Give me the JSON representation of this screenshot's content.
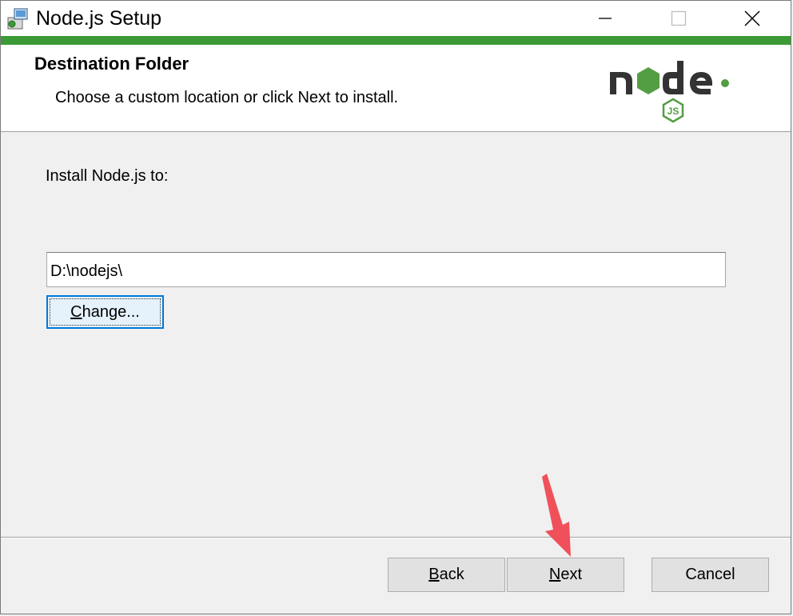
{
  "window": {
    "title": "Node.js Setup"
  },
  "header": {
    "title": "Destination Folder",
    "subtitle": "Choose a custom location or click Next to install."
  },
  "logo": {
    "brand_word": "node",
    "badge": "JS",
    "colors": {
      "dark": "#333333",
      "green": "#539e43"
    }
  },
  "form": {
    "install_label": "Install Node.js to:",
    "path_value": "D:\\nodejs\\",
    "change_button": {
      "mnemonic": "C",
      "rest": "hange..."
    }
  },
  "buttons": {
    "back": {
      "mnemonic": "B",
      "rest": "ack"
    },
    "next": {
      "mnemonic": "N",
      "rest": "ext"
    },
    "cancel": "Cancel"
  },
  "colors": {
    "accent": "#3b9a35",
    "focus_border": "#0078d7",
    "annotation_arrow": "#f0505a"
  }
}
